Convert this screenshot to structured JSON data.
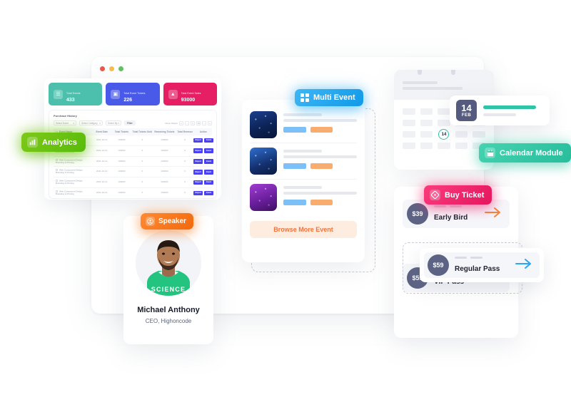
{
  "window": {
    "traffic_lights": [
      "close",
      "minimize",
      "maximize"
    ]
  },
  "dashboard": {
    "stats": [
      {
        "label": "Total Events",
        "value": "433",
        "color": "#4cc0ac",
        "icon": "list-icon"
      },
      {
        "label": "Total Event Tickets",
        "value": "226",
        "color": "#4a5ae8",
        "icon": "ticket-icon"
      },
      {
        "label": "Total Event Sales",
        "value": "93000",
        "color": "#e61e63",
        "icon": "chart-icon"
      }
    ],
    "table": {
      "title": "Purchase History",
      "toolbar": {
        "select_event": "Select Event",
        "select_category": "Select Category",
        "select_by": "Select By",
        "filter_button": "Filter",
        "rows_label": "Rows Shown",
        "page_value": "10"
      },
      "columns": [
        "Event Name",
        "Event Date",
        "Total Tickets",
        "Total Tickets Sold",
        "Remaining Tickets",
        "Total Revenue",
        "Action"
      ],
      "rows": [
        {
          "event": "Web Component Design Branding & Printing",
          "date": "2021-10-12",
          "total": "100000",
          "sold": "0",
          "remaining": "100000",
          "revenue": "0",
          "actions": [
            "Report",
            "Event"
          ]
        },
        {
          "event": "Web Component Design Branding & Printing",
          "date": "2021-10-12",
          "total": "100000",
          "sold": "0",
          "remaining": "100000",
          "revenue": "0",
          "actions": [
            "Report",
            "Event"
          ]
        },
        {
          "event": "Web Component Design Branding & Printing",
          "date": "2021-10-12",
          "total": "100000",
          "sold": "0",
          "remaining": "100000",
          "revenue": "0",
          "actions": [
            "Report",
            "Event"
          ]
        },
        {
          "event": "Web Component Design Branding & Printing",
          "date": "2021-10-12",
          "total": "100000",
          "sold": "0",
          "remaining": "100000",
          "revenue": "0",
          "actions": [
            "Report",
            "Event"
          ]
        },
        {
          "event": "Web Component Design Branding & Printing",
          "date": "2021-10-12",
          "total": "100000",
          "sold": "0",
          "remaining": "100000",
          "revenue": "0",
          "actions": [
            "Report",
            "Event"
          ]
        },
        {
          "event": "Web Component Design Branding & Printing",
          "date": "2021-10-12",
          "total": "100000",
          "sold": "0",
          "remaining": "100000",
          "revenue": "0",
          "actions": [
            "Report",
            "Event"
          ]
        }
      ]
    }
  },
  "badges": {
    "analytics": {
      "label": "Analytics",
      "icon": "bar-chart-icon",
      "color": "#68c20f"
    },
    "multi_event": {
      "label": "Multi Event",
      "icon": "grid-icon",
      "color": "#27a9e8"
    },
    "calendar": {
      "label": "Calendar Module",
      "icon": "calendar-icon",
      "color": "#2ec4a5"
    },
    "buy_ticket": {
      "label": "Buy Ticket",
      "icon": "ticket-icon",
      "color": "#e91a62"
    },
    "speaker": {
      "label": "Speaker",
      "icon": "user-circle-icon",
      "color": "#f2690c"
    }
  },
  "multi_event": {
    "events": [
      {
        "thumb": "crowd-blue-photo",
        "tag_primary_color": "#7cc0f7",
        "tag_secondary_color": "#f8ad6e"
      },
      {
        "thumb": "stage-lights-photo",
        "tag_primary_color": "#7cc0f7",
        "tag_secondary_color": "#f8ad6e"
      },
      {
        "thumb": "concert-purple-photo",
        "tag_primary_color": "#7cc0f7",
        "tag_secondary_color": "#f8ad6e"
      }
    ],
    "browse_button": "Browse More Event"
  },
  "calendar": {
    "date_day": "14",
    "date_month": "FEB",
    "today_marker": "14",
    "accent_color": "#2ec4a5",
    "grid_rows": 4,
    "grid_cols": 5
  },
  "tickets": [
    {
      "price": "$39",
      "name": "Early Bird",
      "arrow_color": "#f3873c",
      "arrow_icon": "arrow-right-icon"
    },
    {
      "price": "$59",
      "name": "Regular Pass",
      "arrow_color": "#2ba6f0",
      "arrow_icon": "arrow-right-icon"
    },
    {
      "price": "$59",
      "name": "VIP Pass",
      "arrow_color": "#e91a62",
      "arrow_icon": "arrow-right-icon"
    }
  ],
  "speaker": {
    "name": "Michael Anthony",
    "role": "CEO, Highoncode",
    "shirt_text": "SCIENCE"
  }
}
